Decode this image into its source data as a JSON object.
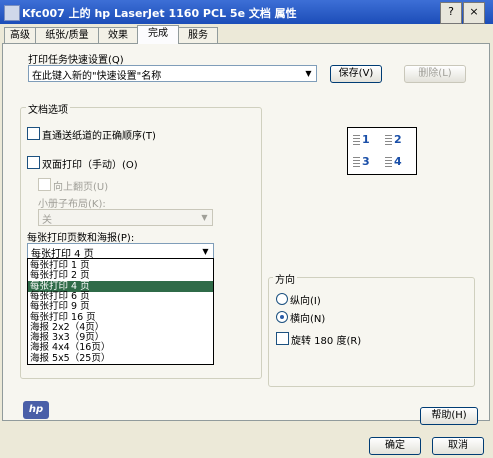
{
  "window": {
    "title": "Kfc007 上的 hp LaserJet 1160 PCL 5e 文档 属性",
    "help_glyph": "?",
    "close_glyph": "×"
  },
  "tabs": [
    {
      "label": "高级"
    },
    {
      "label": "纸张/质量"
    },
    {
      "label": "效果"
    },
    {
      "label": "完成"
    },
    {
      "label": "服务"
    }
  ],
  "quick_settings": {
    "label": "打印任务快速设置(Q)",
    "value": "在此键入新的\"快速设置\"名称",
    "save_label": "保存(V)",
    "delete_label": "删除(L)"
  },
  "doc_options": {
    "title": "文档选项",
    "straight_paper_path": "直通送纸道的正确顺序(T)",
    "duplex": "双面打印（手动）(O)",
    "flip_pages_up": "向上翻页(U)",
    "booklet_label": "小册子布局(K):",
    "booklet_value": "关",
    "pages_per_sheet_label": "每张打印页数和海报(P):",
    "pages_per_sheet_value": "每张打印 4 页",
    "options": [
      "每张打印 1 页",
      "每张打印 2 页",
      "每张打印 4 页",
      "每张打印 6 页",
      "每张打印 9 页",
      "每张打印 16 页",
      "海报 2x2（4页）",
      "海报 3x3（9页）",
      "海报 4x4（16页）",
      "海报 5x5（25页）"
    ],
    "selected_index": 2
  },
  "preview": {
    "cells": [
      "1",
      "2",
      "3",
      "4"
    ]
  },
  "orientation": {
    "title": "方向",
    "portrait": "纵向(I)",
    "landscape": "横向(N)",
    "rotate": "旋转 180 度(R)",
    "selected": "landscape"
  },
  "logo_text": "hp",
  "footer": {
    "help_label": "帮助(H)",
    "ok_label": "确定",
    "cancel_label": "取消"
  }
}
